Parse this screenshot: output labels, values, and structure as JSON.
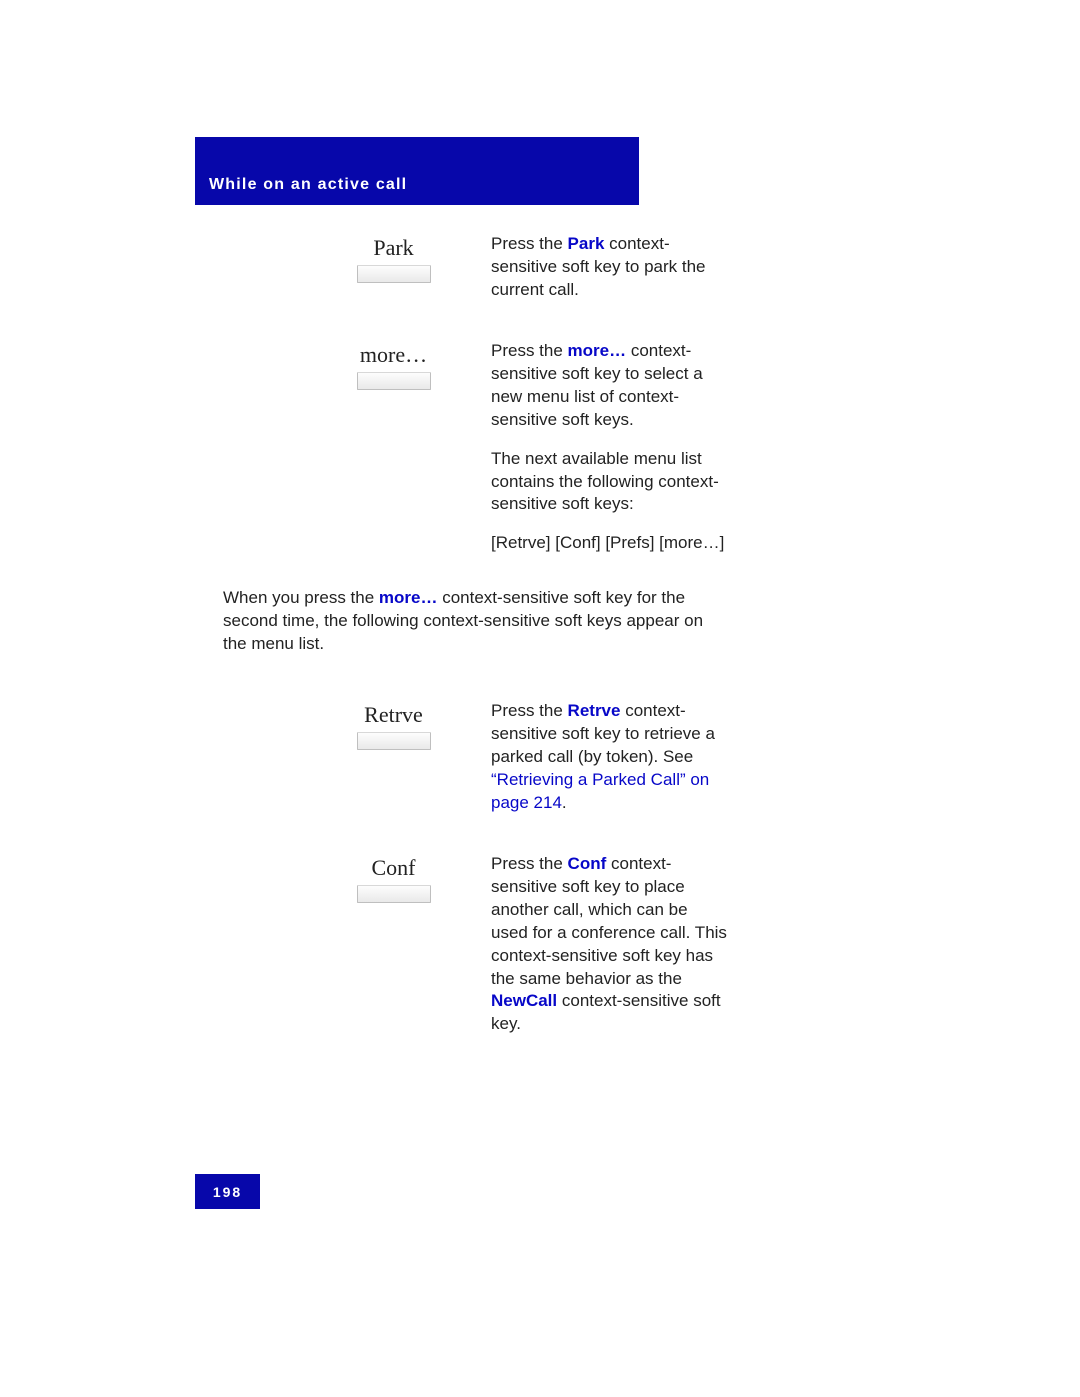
{
  "header": {
    "title": "While on an active call"
  },
  "rows": [
    {
      "keyLabel": "Park",
      "descPrefix": "Press the ",
      "bold": "Park",
      "descAfter": " context-sensitive soft key to park the current call."
    },
    {
      "keyLabel": "more…",
      "descPrefix": "Press the ",
      "bold": "more…",
      "descAfter": " context-sensitive soft key to select a new menu list of context-sensitive soft keys.",
      "extra1": "The next available menu list contains the following context-sensitive soft keys:",
      "extra2": "[Retrve] [Conf] [Prefs] [more…]"
    }
  ],
  "interText": {
    "prefix": "When you press the ",
    "bold": "more…",
    "suffix": " context-sensitive soft key for the second time, the following context-sensitive soft keys appear on the menu list."
  },
  "rows2": [
    {
      "keyLabel": "Retrve",
      "descPrefix": "Press the ",
      "bold": "Retrve",
      "descAfter": " context-sensitive soft key to retrieve a parked call (by token). See ",
      "link": "“Retrieving a Parked Call” on page 214",
      "descEnd": "."
    },
    {
      "keyLabel": "Conf",
      "descPrefix": "Press the ",
      "bold": "Conf",
      "descAfter": " context-sensitive soft key to place another call, which can be used for a conference call. This context-sensitive soft key has the same behavior as the ",
      "bold2": "NewCall",
      "descEnd": " context-sensitive soft key."
    }
  ],
  "footer": {
    "pageNumber": "198"
  }
}
